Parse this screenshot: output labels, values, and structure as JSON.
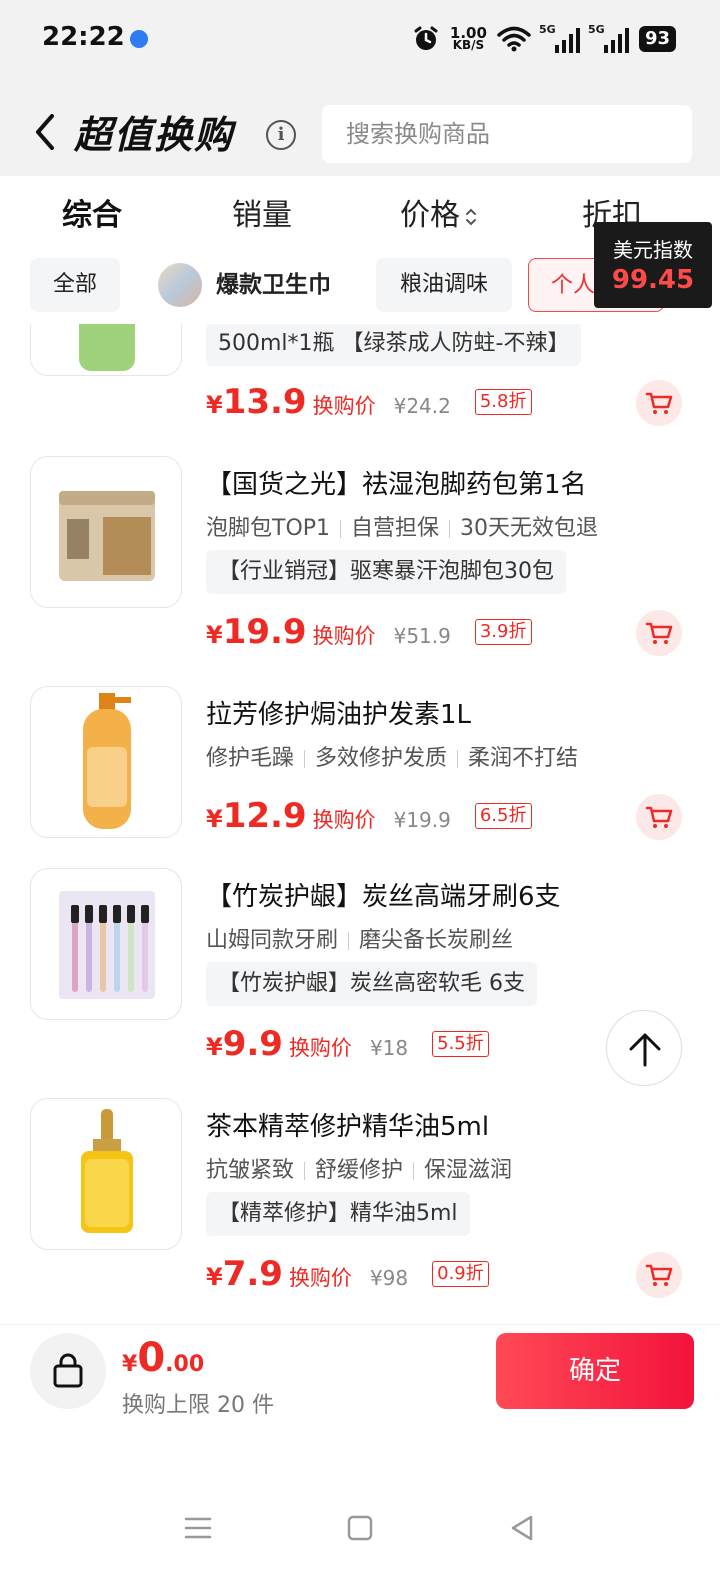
{
  "status": {
    "time": "22:22",
    "speed_value": "1.00",
    "speed_unit": "KB/S",
    "net1": "5G",
    "net2": "5G",
    "battery": "93"
  },
  "header": {
    "title": "超值换购",
    "search_placeholder": "搜索换购商品"
  },
  "sort": {
    "items": [
      "综合",
      "销量",
      "价格",
      "折扣"
    ]
  },
  "chips": {
    "all": "全部",
    "featured": "爆款卫生巾",
    "grain": "粮油调味",
    "personal": "个人"
  },
  "tooltip": {
    "label": "美元指数",
    "value": "99.45"
  },
  "products": [
    {
      "title": "",
      "tags": [],
      "promo": "500ml*1瓶 【绿茶成人防蛀-不辣】",
      "yen": "¥",
      "price": "13.9",
      "price_label": "换购价",
      "original": "¥24.2",
      "discount": "5.8折"
    },
    {
      "title": "【国货之光】祛湿泡脚药包第1名",
      "tags": [
        "泡脚包TOP1",
        "自营担保",
        "30天无效包退"
      ],
      "promo": "【行业销冠】驱寒暴汗泡脚包30包",
      "yen": "¥",
      "price": "19.9",
      "price_label": "换购价",
      "original": "¥51.9",
      "discount": "3.9折"
    },
    {
      "title": "拉芳修护焗油护发素1L",
      "tags": [
        "修护毛躁",
        "多效修护发质",
        "柔润不打结"
      ],
      "promo": "",
      "yen": "¥",
      "price": "12.9",
      "price_label": "换购价",
      "original": "¥19.9",
      "discount": "6.5折"
    },
    {
      "title": "【竹炭护龈】炭丝高端牙刷6支",
      "tags": [
        "山姆同款牙刷",
        "磨尖备长炭刷丝"
      ],
      "promo": "【竹炭护龈】炭丝高密软毛 6支",
      "yen": "¥",
      "price": "9.9",
      "price_label": "换购价",
      "original": "¥18",
      "discount": "5.5折"
    },
    {
      "title": "茶本精萃修护精华油5ml",
      "tags": [
        "抗皱紧致",
        "舒缓修护",
        "保湿滋润"
      ],
      "promo": "【精萃修护】精华油5ml",
      "yen": "¥",
      "price": "7.9",
      "price_label": "换购价",
      "original": "¥98",
      "discount": "0.9折"
    }
  ],
  "footer": {
    "yen": "¥",
    "total_int": "0",
    "total_dec": ".00",
    "limit": "换购上限 20 件",
    "confirm": "确定"
  },
  "colors": {
    "accent": "#ee2a24",
    "confirm_gradient_start": "#ff4a56",
    "confirm_gradient_end": "#f3123b"
  }
}
